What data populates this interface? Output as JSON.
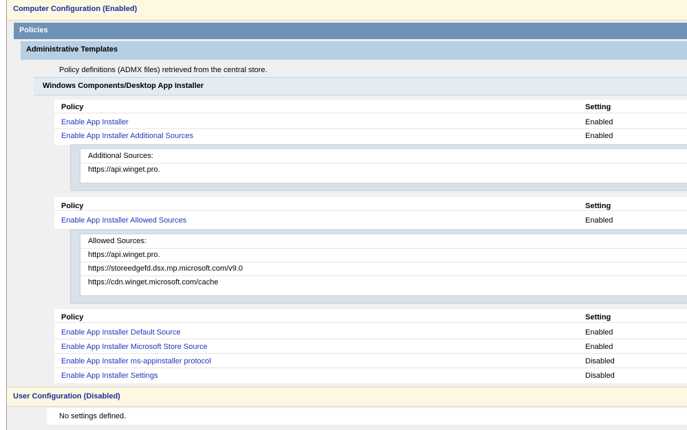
{
  "computer_config": {
    "title": "Computer Configuration (Enabled)"
  },
  "policies": {
    "title": "Policies"
  },
  "admin_templates": {
    "title": "Administrative Templates",
    "note": "Policy definitions (ADMX files) retrieved from the central store."
  },
  "category": {
    "title": "Windows Components/Desktop App Installer"
  },
  "table_headers": {
    "policy": "Policy",
    "setting": "Setting"
  },
  "group1": {
    "rows": [
      {
        "name": "Enable App Installer",
        "setting": "Enabled"
      },
      {
        "name": "Enable App Installer Additional Sources",
        "setting": "Enabled"
      }
    ],
    "box": {
      "label": "Additional Sources:",
      "values": [
        "https://api.winget.pro."
      ]
    }
  },
  "group2": {
    "rows": [
      {
        "name": "Enable App Installer Allowed Sources",
        "setting": "Enabled"
      }
    ],
    "box": {
      "label": "Allowed Sources:",
      "values": [
        "https://api.winget.pro.",
        "https://storeedgefd.dsx.mp.microsoft.com/v9.0",
        "https://cdn.winget.microsoft.com/cache"
      ]
    }
  },
  "group3": {
    "rows": [
      {
        "name": "Enable App Installer Default Source",
        "setting": "Enabled"
      },
      {
        "name": "Enable App Installer Microsoft Store Source",
        "setting": "Enabled"
      },
      {
        "name": "Enable App Installer ms-appinstaller protocol",
        "setting": "Disabled"
      },
      {
        "name": "Enable App Installer Settings",
        "setting": "Disabled"
      }
    ]
  },
  "user_config": {
    "title": "User Configuration (Disabled)",
    "note": "No settings defined."
  }
}
